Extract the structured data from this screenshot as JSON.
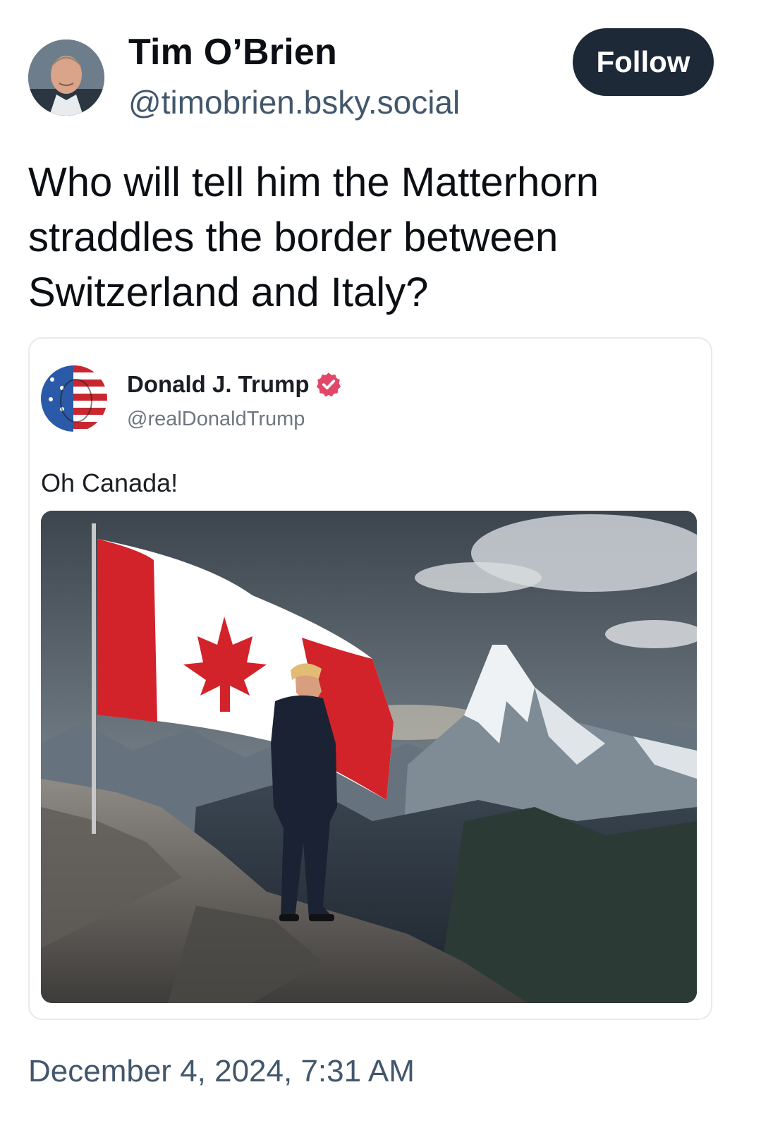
{
  "post": {
    "author_name": "Tim O’Brien",
    "author_handle": "@timobrien.bsky.social",
    "follow_label": "Follow",
    "text": "Who will tell him the Matterhorn straddles the border between Switzerland and Italy?",
    "timestamp": "December 4, 2024, 7:31 AM"
  },
  "quoted_post": {
    "author_name": "Donald J. Trump",
    "author_handle": "@realDonaldTrump",
    "verified_icon": "verified-badge-icon",
    "text": "Oh Canada!",
    "image_alt": "Man in a dark suit standing on a rocky summit beside a Canadian flag, facing a snowy pyramid-shaped mountain"
  },
  "colors": {
    "follow_button_bg": "#1e2937",
    "handle_text": "#42576c",
    "verified_badge": "#e2476a",
    "card_border": "#e6e9ed"
  }
}
